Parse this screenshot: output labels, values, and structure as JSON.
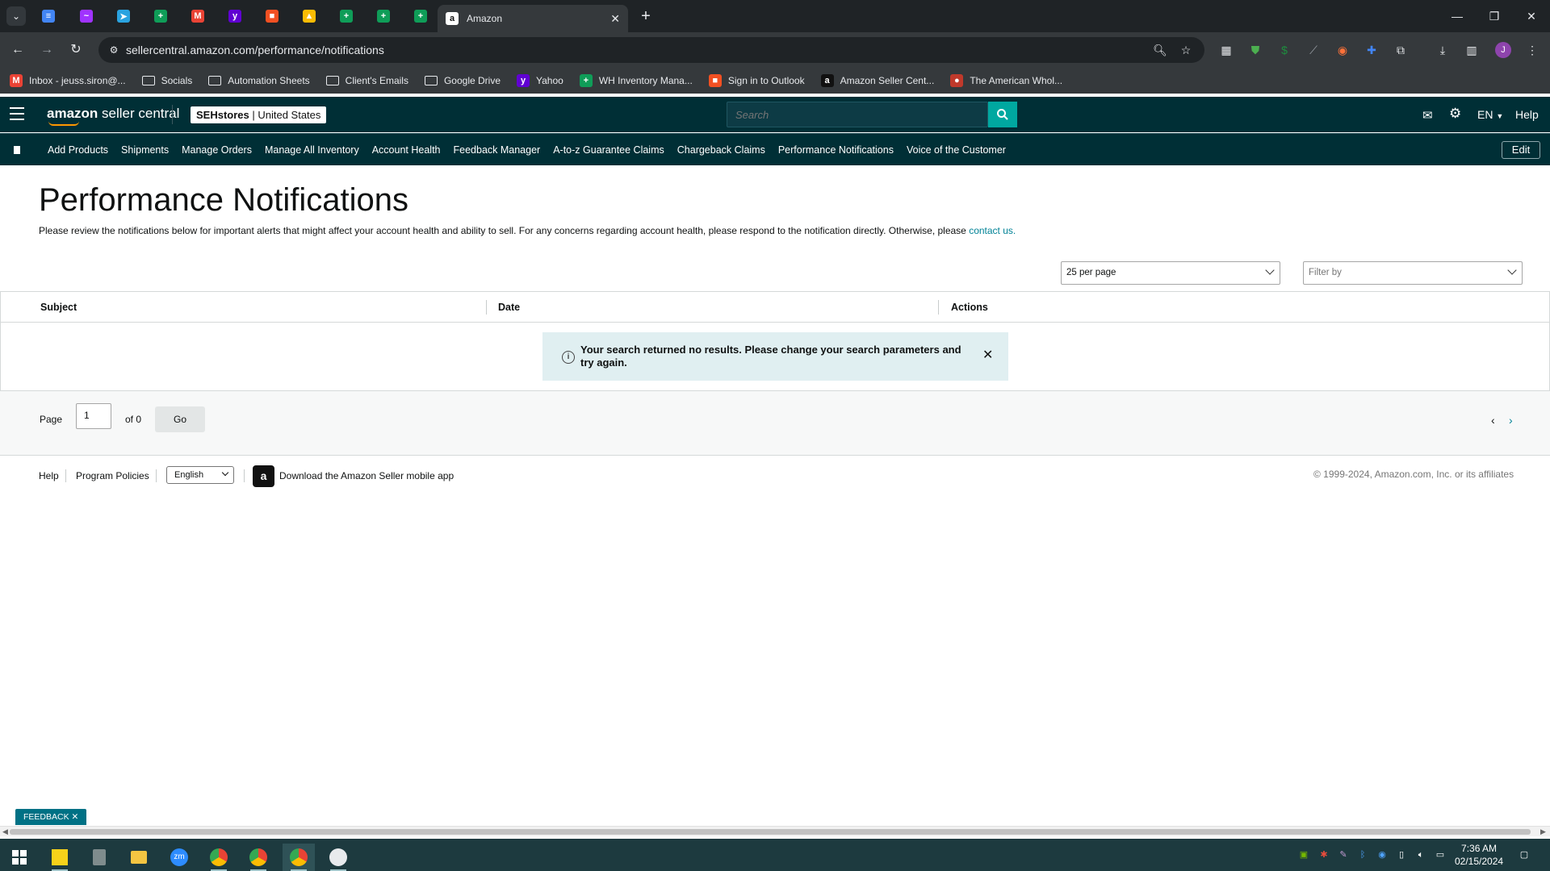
{
  "browser": {
    "active_tab_title": "Amazon",
    "url": "sellercentral.amazon.com/performance/notifications",
    "pinned_tabs": [
      {
        "name": "docs",
        "color": "#4285f4",
        "glyph": "≡"
      },
      {
        "name": "messenger",
        "color": "#a033ff",
        "glyph": "~"
      },
      {
        "name": "telegram",
        "color": "#2aa3e0",
        "glyph": "➤"
      },
      {
        "name": "sheets",
        "color": "#0f9d58",
        "glyph": "+"
      },
      {
        "name": "gmail",
        "color": "#ea4335",
        "glyph": "M"
      },
      {
        "name": "yahoo",
        "color": "#6001d2",
        "glyph": "y"
      },
      {
        "name": "microsoft",
        "color": "#f25022",
        "glyph": "■"
      },
      {
        "name": "drive",
        "color": "#fbbc04",
        "glyph": "▲"
      },
      {
        "name": "sheets",
        "color": "#0f9d58",
        "glyph": "+"
      },
      {
        "name": "sheets",
        "color": "#0f9d58",
        "glyph": "+"
      },
      {
        "name": "sheets",
        "color": "#0f9d58",
        "glyph": "+"
      }
    ],
    "bookmarks": [
      {
        "label": "Inbox - jeuss.siron@...",
        "icon": "gmail-icon",
        "type": "site",
        "color": "#ea4335",
        "glyph": "M"
      },
      {
        "label": "Socials",
        "icon": "folder-icon",
        "type": "folder"
      },
      {
        "label": "Automation Sheets",
        "icon": "folder-icon",
        "type": "folder"
      },
      {
        "label": "Client's Emails",
        "icon": "folder-icon",
        "type": "folder"
      },
      {
        "label": "Google Drive",
        "icon": "folder-icon",
        "type": "folder"
      },
      {
        "label": "Yahoo",
        "icon": "yahoo-icon",
        "type": "site",
        "color": "#6001d2",
        "glyph": "y"
      },
      {
        "label": "WH Inventory Mana...",
        "icon": "sheets-icon",
        "type": "site",
        "color": "#0f9d58",
        "glyph": "+"
      },
      {
        "label": "Sign in to Outlook",
        "icon": "microsoft-icon",
        "type": "site",
        "color": "#f25022",
        "glyph": "■"
      },
      {
        "label": "Amazon Seller Cent...",
        "icon": "amazon-icon",
        "type": "site",
        "color": "#111111",
        "glyph": "a"
      },
      {
        "label": "The American Whol...",
        "icon": "wholesale-icon",
        "type": "site",
        "color": "#c0392b",
        "glyph": "●"
      }
    ]
  },
  "header": {
    "logo_brand": "amazon",
    "logo_suffix": " seller central",
    "store_name": "SEHstores",
    "store_region": " | United States",
    "search_placeholder": "Search",
    "language": "EN",
    "help": "Help"
  },
  "nav": {
    "items": [
      "Add Products",
      "Shipments",
      "Manage Orders",
      "Manage All Inventory",
      "Account Health",
      "Feedback Manager",
      "A-to-z Guarantee Claims",
      "Chargeback Claims",
      "Performance Notifications",
      "Voice of the Customer"
    ],
    "edit": "Edit"
  },
  "main": {
    "title": "Performance Notifications",
    "description": "Please review the notifications below for important alerts that might affect your account health and ability to sell. For any concerns regarding account health, please respond to the notification directly. Otherwise, please ",
    "contact_link": "contact us.",
    "per_page": "25 per page",
    "filter_placeholder": "Filter by",
    "columns": [
      "Subject",
      "Date",
      "Actions"
    ],
    "empty_message": "Your search returned no results. Please change your search parameters and try again.",
    "pager": {
      "page_label": "Page",
      "page_value": "1",
      "of_label": "of 0",
      "go": "Go"
    }
  },
  "footer": {
    "help": "Help",
    "program_policies": "Program Policies",
    "language": "English",
    "app_text": "Download the Amazon Seller mobile app",
    "copyright": "© 1999-2024, Amazon.com, Inc. or its affiliates"
  },
  "feedback": "FEEDBACK",
  "taskbar": {
    "time": "7:36 AM",
    "date": "02/15/2024"
  },
  "colors": {
    "amazon_header": "#002f36",
    "accent_teal": "#00a8a0",
    "link": "#008296",
    "alert_bg": "#e0eff1"
  }
}
